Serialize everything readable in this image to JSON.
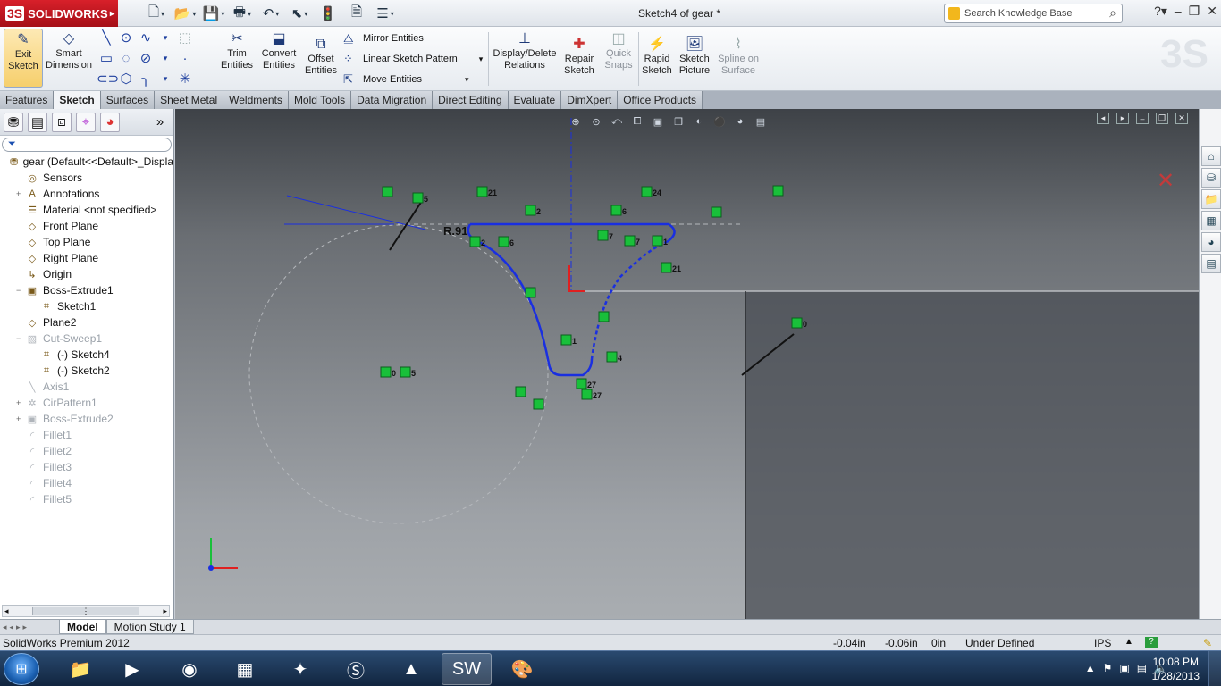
{
  "window": {
    "app_name": "SOLIDWORKS",
    "title": "Sketch4 of gear *",
    "search_placeholder": "Search Knowledge Base"
  },
  "ribbon": {
    "exit_sketch": "Exit Sketch",
    "smart_dimension": "Smart Dimension",
    "trim_entities": "Trim Entities",
    "convert_entities": "Convert Entities",
    "offset_entities": "Offset Entities",
    "mirror_entities": "Mirror Entities",
    "linear_sketch_pattern": "Linear Sketch Pattern",
    "move_entities": "Move Entities",
    "display_delete_relations": "Display/Delete Relations",
    "repair_sketch": "Repair Sketch",
    "quick_snaps": "Quick Snaps",
    "rapid_sketch": "Rapid Sketch",
    "sketch_picture": "Sketch Picture",
    "spline_on_surface": "Spline on Surface"
  },
  "tabs": [
    "Features",
    "Sketch",
    "Surfaces",
    "Sheet Metal",
    "Weldments",
    "Mold Tools",
    "Data Migration",
    "Direct Editing",
    "Evaluate",
    "DimXpert",
    "Office Products"
  ],
  "active_tab": "Sketch",
  "feature_tree": [
    {
      "label": "gear  (Default<<Default>_Displa",
      "icon": "part-icon",
      "indent": 0,
      "dim": false,
      "expander": ""
    },
    {
      "label": "Sensors",
      "icon": "sensor-icon",
      "indent": 1,
      "dim": false,
      "expander": ""
    },
    {
      "label": "Annotations",
      "icon": "annotation-icon",
      "indent": 1,
      "dim": false,
      "expander": "+"
    },
    {
      "label": "Material <not specified>",
      "icon": "material-icon",
      "indent": 1,
      "dim": false,
      "expander": ""
    },
    {
      "label": "Front Plane",
      "icon": "plane-icon",
      "indent": 1,
      "dim": false,
      "expander": ""
    },
    {
      "label": "Top Plane",
      "icon": "plane-icon",
      "indent": 1,
      "dim": false,
      "expander": ""
    },
    {
      "label": "Right Plane",
      "icon": "plane-icon",
      "indent": 1,
      "dim": false,
      "expander": ""
    },
    {
      "label": "Origin",
      "icon": "origin-icon",
      "indent": 1,
      "dim": false,
      "expander": ""
    },
    {
      "label": "Boss-Extrude1",
      "icon": "extrude-icon",
      "indent": 1,
      "dim": false,
      "expander": "−"
    },
    {
      "label": "Sketch1",
      "icon": "sketch-icon",
      "indent": 2,
      "dim": false,
      "expander": ""
    },
    {
      "label": "Plane2",
      "icon": "plane-icon",
      "indent": 1,
      "dim": false,
      "expander": ""
    },
    {
      "label": "Cut-Sweep1",
      "icon": "cut-sweep-icon",
      "indent": 1,
      "dim": true,
      "expander": "−"
    },
    {
      "label": "(-) Sketch4",
      "icon": "sketch-icon",
      "indent": 2,
      "dim": false,
      "expander": ""
    },
    {
      "label": "(-) Sketch2",
      "icon": "sketch-icon",
      "indent": 2,
      "dim": false,
      "expander": ""
    },
    {
      "label": "Axis1",
      "icon": "axis-icon",
      "indent": 1,
      "dim": true,
      "expander": ""
    },
    {
      "label": "CirPattern1",
      "icon": "pattern-icon",
      "indent": 1,
      "dim": true,
      "expander": "+"
    },
    {
      "label": "Boss-Extrude2",
      "icon": "extrude-icon",
      "indent": 1,
      "dim": true,
      "expander": "+"
    },
    {
      "label": "Fillet1",
      "icon": "fillet-icon",
      "indent": 1,
      "dim": true,
      "expander": ""
    },
    {
      "label": "Fillet2",
      "icon": "fillet-icon",
      "indent": 1,
      "dim": true,
      "expander": ""
    },
    {
      "label": "Fillet3",
      "icon": "fillet-icon",
      "indent": 1,
      "dim": true,
      "expander": ""
    },
    {
      "label": "Fillet4",
      "icon": "fillet-icon",
      "indent": 1,
      "dim": true,
      "expander": ""
    },
    {
      "label": "Fillet5",
      "icon": "fillet-icon",
      "indent": 1,
      "dim": true,
      "expander": ""
    }
  ],
  "sketch": {
    "dimension_label": "R.91",
    "relations": [
      "5",
      "21",
      "2",
      "24",
      "6",
      "2",
      "6",
      "7",
      "7",
      "1",
      "21",
      "1",
      "0",
      "5",
      "4",
      "27",
      "27",
      "0"
    ]
  },
  "bottom_tabs": [
    "Model",
    "Motion Study 1"
  ],
  "status": {
    "product": "SolidWorks Premium 2012",
    "x": "-0.04in",
    "y": "-0.06in",
    "z": "0in",
    "state": "Under Defined",
    "units": "IPS"
  },
  "taskbar": {
    "time": "10:08 PM",
    "date": "1/28/2013"
  },
  "colors": {
    "sketch_blue": "#1a2fe0",
    "relation_green": "#19c03a",
    "brand_red": "#c0141c"
  }
}
